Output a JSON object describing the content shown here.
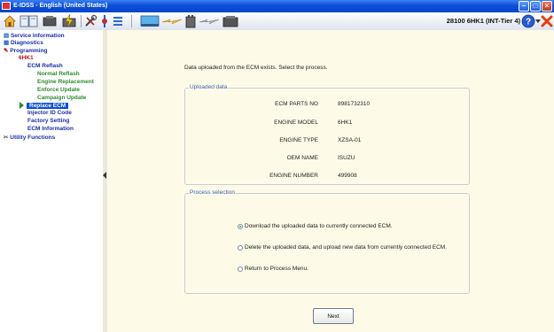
{
  "window": {
    "title": "E-IDSS - English (United States)"
  },
  "toolbar": {
    "vehicle": "28100 6HK1 (INT-Tier 4)",
    "icons": [
      "home-icon",
      "book-icon",
      "engine-icon",
      "flash-icon",
      "tools-icon",
      "probe-icon",
      "list-icon",
      "monitor-icon",
      "lightning-icon",
      "battery-icon",
      "lightning-grey-icon",
      "engine-grey-icon",
      "help-icon",
      "close-icon"
    ]
  },
  "tree": {
    "service_information": "Service Information",
    "diagnostics": "Diagnostics",
    "programming": "Programming",
    "engine": "6HK1",
    "ecm_reflash": "ECM Reflash",
    "normal_reflash": "Normal Reflash",
    "engine_replacement": "Engine Replacement",
    "enforce_update": "Enforce Update",
    "campaign_update": "Campaign Update",
    "replace_ecm": "Replace ECM",
    "injector_id_code": "Injector ID Code",
    "factory_setting": "Factory Setting",
    "ecm_information": "ECM Information",
    "utility_functions": "Utility Functions"
  },
  "main": {
    "intro": "Data uploaded from the ECM exists. Select the process.",
    "uploaded": {
      "legend": "Uploaded data",
      "rows": [
        {
          "label": "ECM PARTS NO",
          "value": "8981732310"
        },
        {
          "label": "ENGINE MODEL",
          "value": "6HK1"
        },
        {
          "label": "ENGINE TYPE",
          "value": "XZSA-01"
        },
        {
          "label": "OEM NAME",
          "value": "ISUZU"
        },
        {
          "label": "ENGINE NUMBER",
          "value": "499908"
        }
      ]
    },
    "process": {
      "legend": "Process selection",
      "options": [
        "Download the uploaded data to currently connected ECM.",
        "Delete the uploaded data, and upload new data from currently connected ECM.",
        "Return to Process Menu."
      ],
      "selected": 0
    },
    "next_label": "Next"
  },
  "colors": {
    "title_bar": "#0a4fd6",
    "tree_red": "#c0141c",
    "tree_green": "#2f8a2f",
    "tree_blue": "#1a2ea8",
    "selected_bg": "#0a4fd6",
    "main_bg": "#fdfbe8"
  }
}
